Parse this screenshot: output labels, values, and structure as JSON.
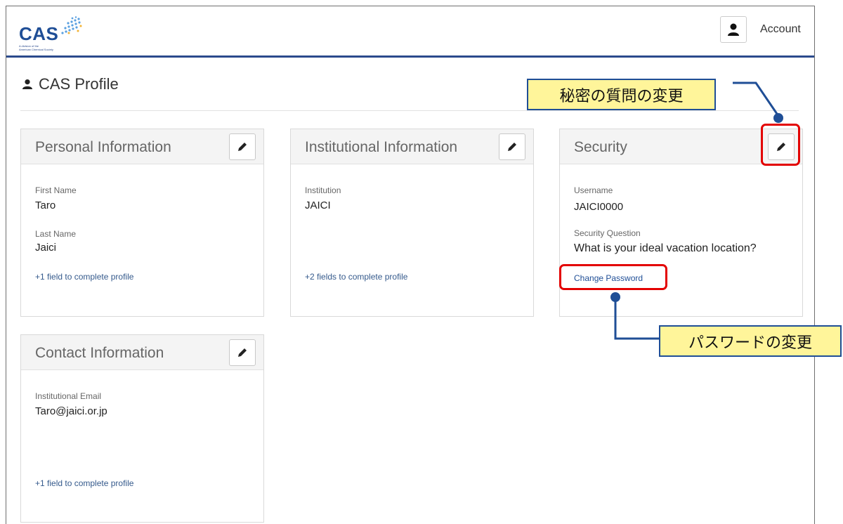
{
  "header": {
    "logo_text": "CAS",
    "logo_tagline_1": "A division of the",
    "logo_tagline_2": "American Chemical Society",
    "account_label": "Account"
  },
  "page": {
    "title": "CAS Profile"
  },
  "cards": {
    "personal": {
      "title": "Personal Information",
      "first_name_label": "First Name",
      "first_name_value": "Taro",
      "last_name_label": "Last Name",
      "last_name_value": "Jaici",
      "complete_text": "+1 field to complete profile"
    },
    "institutional": {
      "title": "Institutional Information",
      "institution_label": "Institution",
      "institution_value": "JAICI",
      "complete_text": "+2 fields to complete profile"
    },
    "security": {
      "title": "Security",
      "username_label": "Username",
      "username_value": "JAICI0000",
      "question_label": "Security Question",
      "question_value": "What is your ideal vacation location?",
      "change_password_label": "Change Password"
    },
    "contact": {
      "title": "Contact Information",
      "email_label": "Institutional Email",
      "email_value": "Taro@jaici.or.jp",
      "complete_text": "+1 field to complete profile"
    }
  },
  "annotations": {
    "security_question_change": "秘密の質問の変更",
    "password_change": "パスワードの変更"
  },
  "icons": {
    "account": "user-icon",
    "title": "user-icon",
    "edit": "pencil-icon"
  },
  "colors": {
    "brand": "#1f4e96",
    "header_rule": "#2b4a8c",
    "highlight": "#e30000",
    "callout_bg": "#fff59a"
  }
}
